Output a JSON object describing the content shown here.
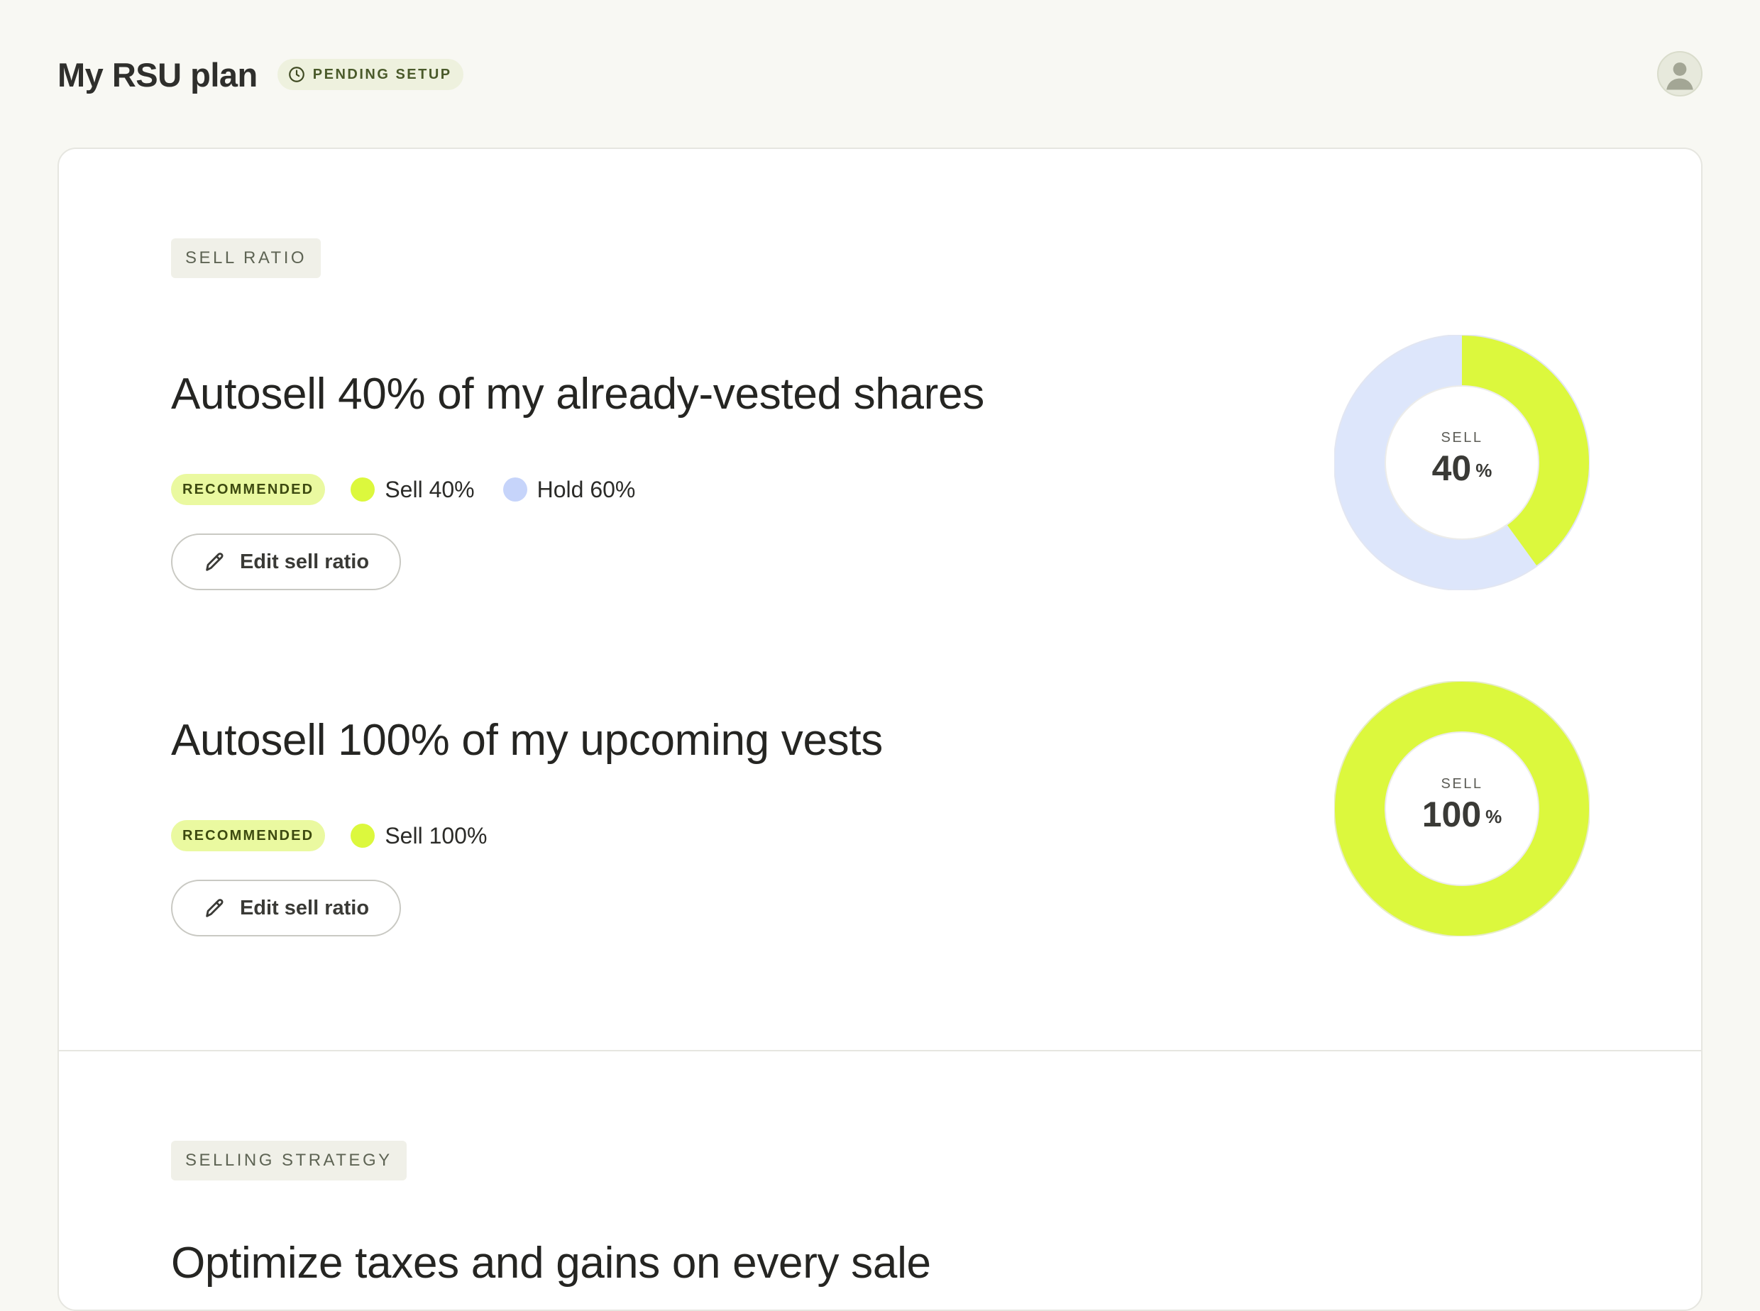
{
  "header": {
    "title": "My RSU plan",
    "status": "PENDING SETUP",
    "status_icon": "clock-icon",
    "avatar_icon": "user-avatar-icon"
  },
  "sell_ratio": {
    "tag": "SELL RATIO",
    "plans": [
      {
        "title": "Autosell 40% of my already-vested shares",
        "badge": "RECOMMENDED",
        "legend": [
          {
            "label": "Sell 40%",
            "color": "#dcf83d"
          },
          {
            "label": "Hold 60%",
            "color": "#c6d4fa"
          }
        ],
        "edit_label": "Edit sell ratio",
        "donut_caption": "SELL",
        "donut_value": "40",
        "donut_unit": "%",
        "sell_fraction": 0.4
      },
      {
        "title": "Autosell 100% of my upcoming vests",
        "badge": "RECOMMENDED",
        "legend": [
          {
            "label": "Sell 100%",
            "color": "#dcf83d"
          }
        ],
        "edit_label": "Edit sell ratio",
        "donut_caption": "SELL",
        "donut_value": "100",
        "donut_unit": "%",
        "sell_fraction": 1.0
      }
    ]
  },
  "selling_strategy": {
    "tag": "SELLING STRATEGY",
    "title": "Optimize taxes and gains on every sale"
  },
  "colors": {
    "sell": "#dcf83d",
    "hold": "#c6d4fa",
    "background": "#f8f8f3"
  }
}
